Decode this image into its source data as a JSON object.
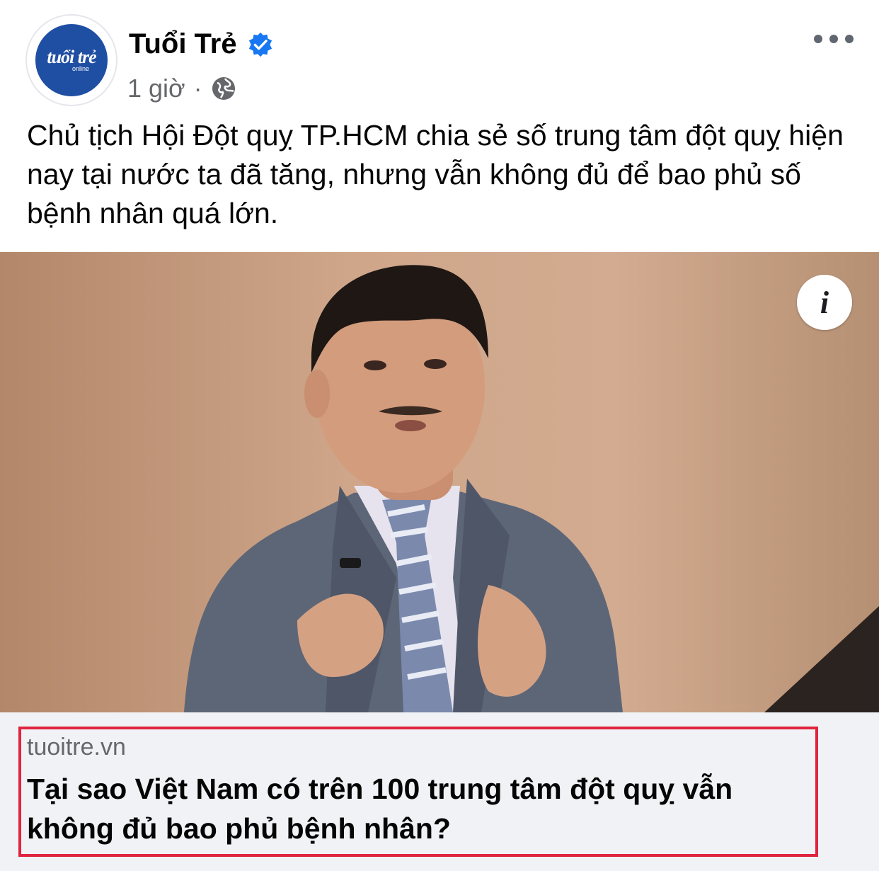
{
  "post": {
    "author": {
      "name": "Tuổi Trẻ",
      "verified": true,
      "avatar_logo_text": "tuổi trẻ",
      "avatar_logo_subtext": "online"
    },
    "meta": {
      "time": "1 giờ",
      "separator": "·",
      "audience_icon": "globe-icon"
    },
    "more_icon": "more-horizontal-icon",
    "text": "Chủ tịch Hội Đột quỵ TP.HCM chia sẻ số trung tâm đột quỵ hiện nay tại nước ta đã tăng, nhưng vẫn không đủ để bao phủ số bệnh nhân quá lớn.",
    "image": {
      "info_icon": "i"
    },
    "link_preview": {
      "domain": "tuoitre.vn",
      "title": "Tại sao Việt Nam có trên 100 trung tâm đột quỵ vẫn không đủ bao phủ bệnh nhân?"
    }
  },
  "colors": {
    "facebook_blue": "#1877f2",
    "avatar_blue": "#1f4fa3",
    "highlight_red": "#e0243f",
    "secondary_text": "#65676b",
    "card_background": "#f0f2f5"
  }
}
